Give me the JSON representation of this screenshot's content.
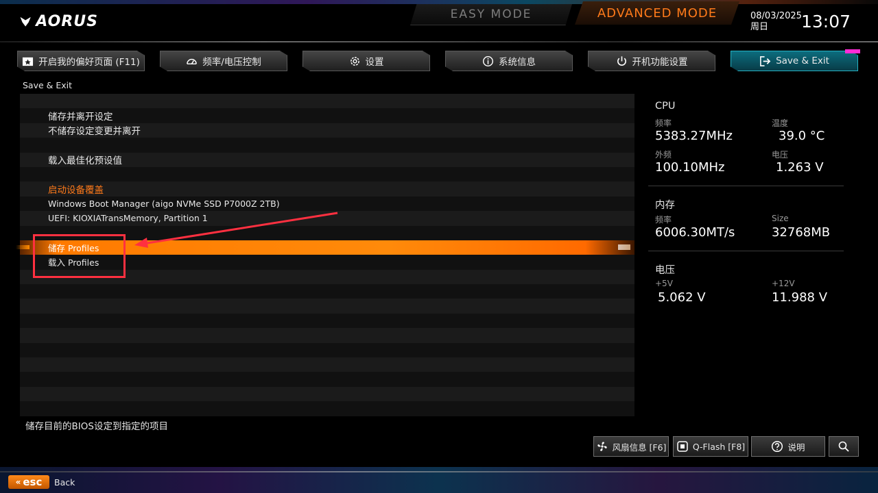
{
  "header": {
    "logo_text": "AORUS",
    "easy_mode": "EASY MODE",
    "advanced_mode": "ADVANCED MODE",
    "date": "08/03/2025",
    "weekday": "周日",
    "time": "13:07"
  },
  "tabs": [
    {
      "label": "开启我的偏好页面 (F11)",
      "icon": "favorite-icon"
    },
    {
      "label": "频率/电压控制",
      "icon": "gauge-icon"
    },
    {
      "label": "设置",
      "icon": "gear-icon"
    },
    {
      "label": "系统信息",
      "icon": "info-icon"
    },
    {
      "label": "开机功能设置",
      "icon": "power-icon"
    },
    {
      "label": "Save & Exit",
      "icon": "exit-icon"
    }
  ],
  "breadcrumb": "Save & Exit",
  "menu": {
    "save_and_exit": "储存并离开设定",
    "exit_without_saving": "不储存设定变更并离开",
    "load_optimized_defaults": "载入最佳化预设值",
    "boot_override_header": "启动设备覆盖",
    "boot_option_1": "Windows Boot Manager (aigo NVMe SSD P7000Z 2TB)",
    "boot_option_2": "UEFI: KIOXIATransMemory, Partition 1",
    "save_profiles": "储存 Profiles",
    "load_profiles": "载入 Profiles"
  },
  "help_text": "储存目前的BIOS设定到指定的项目",
  "cpu": {
    "title": "CPU",
    "freq_label": "频率",
    "freq_value": "5383.27MHz",
    "temp_label": "温度",
    "temp_value": "39.0 °C",
    "bclk_label": "外频",
    "bclk_value": "100.10MHz",
    "voltage_label": "电压",
    "voltage_value": "1.263 V"
  },
  "memory": {
    "title": "内存",
    "freq_label": "频率",
    "freq_value": "6006.30MT/s",
    "size_label": "Size",
    "size_value": "32768MB"
  },
  "voltage": {
    "title": "电压",
    "v5_label": "+5V",
    "v5_value": "5.062 V",
    "v12_label": "+12V",
    "v12_value": "11.988 V"
  },
  "bottom_buttons": {
    "fan_info": "风扇信息 [F6]",
    "qflash": "Q-Flash [F8]",
    "help": "说明"
  },
  "footer": {
    "esc_label": "esc",
    "back_label": "Back"
  },
  "colors": {
    "accent_orange": "#ff7a1a",
    "active_tab": "#0c6d7e",
    "annotation_red": "#ff3040"
  }
}
